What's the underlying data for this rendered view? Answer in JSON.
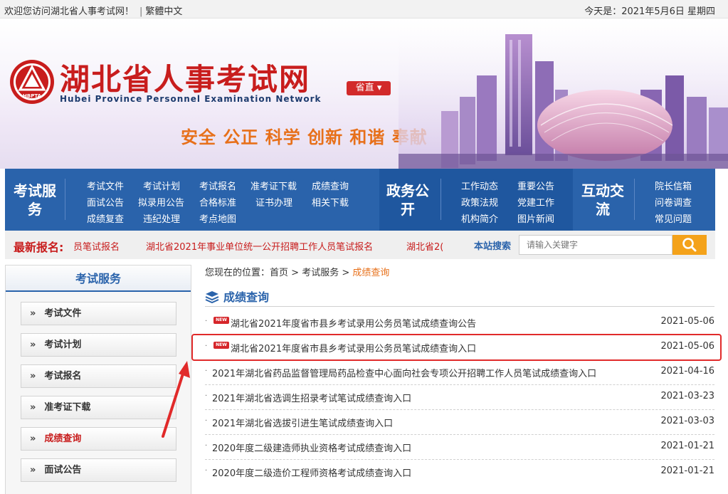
{
  "topbar": {
    "welcome": "欢迎您访问湖北省人事考试网！",
    "traditional": "繁體中文",
    "today_label": "今天是：2021年5月6日 星期四"
  },
  "header": {
    "site_title": "湖北省人事考试网",
    "site_en": "Hubei Province Personnel Examination Network",
    "seal_text": "HBPTA",
    "province_btn": "省直",
    "slogan": "安全 公正 科学 创新 和谐 奉献"
  },
  "nav": {
    "sections": [
      {
        "title": "考试服务",
        "items": [
          "考试文件",
          "考试计划",
          "考试报名",
          "准考证下载",
          "成绩查询",
          "面试公告",
          "拟录用公告",
          "合格标准",
          "证书办理",
          "相关下载",
          "成绩复查",
          "违纪处理",
          "考点地图"
        ]
      },
      {
        "title": "政务公开",
        "items": [
          "工作动态",
          "重要公告",
          "政策法规",
          "党建工作",
          "机构简介",
          "图片新闻"
        ]
      },
      {
        "title": "互动交流",
        "items": [
          "院长信箱",
          "问卷调查",
          "常见问题"
        ]
      }
    ]
  },
  "ticker": {
    "label": "最新报名:",
    "items": [
      "员笔试报名",
      "湖北省2021年事业单位统一公开招聘工作人员笔试报名",
      "湖北省2("
    ],
    "search_label": "本站搜索",
    "search_placeholder": "请输入关键字"
  },
  "sidebar": {
    "title": "考试服务",
    "items": [
      "考试文件",
      "考试计划",
      "考试报名",
      "准考证下载",
      "成绩查询",
      "面试公告"
    ],
    "active_index": 4
  },
  "breadcrumb": {
    "prefix": "您现在的位置：",
    "home": "首页",
    "parent": "考试服务",
    "current": "成绩查询",
    "sep": ">"
  },
  "section": {
    "title": "成绩查询"
  },
  "list": [
    {
      "title": "湖北省2021年度省市县乡考试录用公务员笔试成绩查询公告",
      "date": "2021-05-06",
      "is_new": true
    },
    {
      "title": "湖北省2021年度省市县乡考试录用公务员笔试成绩查询入口",
      "date": "2021-05-06",
      "is_new": true
    },
    {
      "title": "2021年湖北省药品监督管理局药品检查中心面向社会专项公开招聘工作人员笔试成绩查询入口",
      "date": "2021-04-16",
      "is_new": false
    },
    {
      "title": "2021年湖北省选调生招录考试笔试成绩查询入口",
      "date": "2021-03-23",
      "is_new": false
    },
    {
      "title": "2021年湖北省选拔引进生笔试成绩查询入口",
      "date": "2021-03-03",
      "is_new": false
    },
    {
      "title": "2020年度二级建造师执业资格考试成绩查询入口",
      "date": "2021-01-21",
      "is_new": false
    },
    {
      "title": "2020年度二级造价工程师资格考试成绩查询入口",
      "date": "2021-01-21",
      "is_new": false
    }
  ],
  "new_badge": "NEW",
  "colors": {
    "brand_red": "#c81d1d",
    "nav_blue": "#2a63ab",
    "accent_orange": "#e7701a",
    "search_orange": "#f4a21a"
  }
}
